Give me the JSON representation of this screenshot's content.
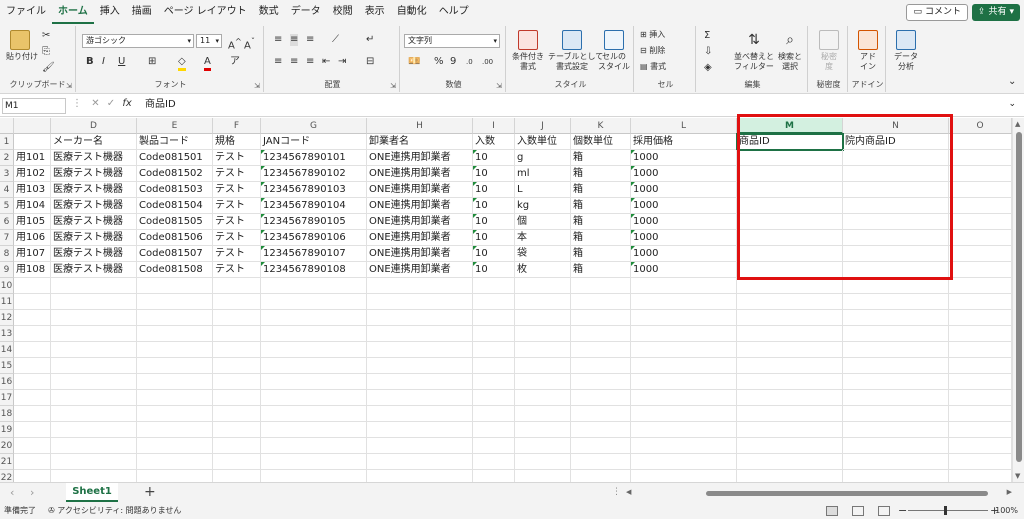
{
  "menu": [
    "ファイル",
    "ホーム",
    "挿入",
    "描画",
    "ページ レイアウト",
    "数式",
    "データ",
    "校閲",
    "表示",
    "自動化",
    "ヘルプ"
  ],
  "active_menu_index": 1,
  "top_buttons": {
    "comment": "コメント",
    "share": "共有"
  },
  "ribbon": {
    "clipboard": {
      "paste": "貼り付け",
      "label": "クリップボード"
    },
    "font": {
      "name": "游ゴシック",
      "size": "11",
      "label": "フォント"
    },
    "alignment": {
      "label": "配置"
    },
    "number": {
      "format": "文字列",
      "label": "数値"
    },
    "styles": {
      "conditional": "条件付き\n書式",
      "table": "テーブルとして\n書式設定",
      "cell_style": "セルの\nスタイル",
      "label": "スタイル"
    },
    "cells": {
      "insert": "挿入",
      "delete": "削除",
      "format": "書式",
      "label": "セル"
    },
    "editing": {
      "sort": "並べ替えと\nフィルター",
      "find": "検索と\n選択",
      "label": "編集"
    },
    "sensitivity": {
      "btn": "秘密\n度",
      "label": "秘密度"
    },
    "addins": {
      "btn": "アド\nイン",
      "label": "アドイン"
    },
    "analyze": {
      "btn": "データ\n分析"
    },
    "colors": {
      "accent": "#1e7145",
      "highlight": "#ffd700",
      "font_color": "#e00000"
    }
  },
  "formula_bar": {
    "name_box": "M1",
    "fx": "fx",
    "content": "商品ID"
  },
  "grid": {
    "columns": [
      {
        "letter": "",
        "width": 37
      },
      {
        "letter": "D",
        "width": 86
      },
      {
        "letter": "E",
        "width": 76
      },
      {
        "letter": "F",
        "width": 48
      },
      {
        "letter": "G",
        "width": 106
      },
      {
        "letter": "H",
        "width": 106
      },
      {
        "letter": "I",
        "width": 42
      },
      {
        "letter": "J",
        "width": 56
      },
      {
        "letter": "K",
        "width": 60
      },
      {
        "letter": "L",
        "width": 106
      },
      {
        "letter": "M",
        "width": 106
      },
      {
        "letter": "N",
        "width": 106
      },
      {
        "letter": "O",
        "width": 63
      }
    ],
    "selected_column": "M",
    "row_numbers": [
      "1",
      "2",
      "3",
      "4",
      "5",
      "6",
      "7",
      "8",
      "9",
      "10",
      "11",
      "12",
      "13",
      "14",
      "15",
      "16",
      "17",
      "18",
      "19",
      "20",
      "21",
      "22"
    ],
    "header_row": [
      "",
      "メーカー名",
      "製品コード",
      "規格",
      "JANコード",
      "卸業者名",
      "入数",
      "入数単位",
      "個数単位",
      "採用価格",
      "商品ID",
      "院内商品ID",
      ""
    ],
    "data_rows": [
      [
        "用101",
        "医療テスト機器",
        "Code081501",
        "テスト",
        "1234567890101",
        "ONE連携用卸業者",
        "10",
        "g",
        "箱",
        "1000",
        "",
        "",
        ""
      ],
      [
        "用102",
        "医療テスト機器",
        "Code081502",
        "テスト",
        "1234567890102",
        "ONE連携用卸業者",
        "10",
        "ml",
        "箱",
        "1000",
        "",
        "",
        ""
      ],
      [
        "用103",
        "医療テスト機器",
        "Code081503",
        "テスト",
        "1234567890103",
        "ONE連携用卸業者",
        "10",
        "L",
        "箱",
        "1000",
        "",
        "",
        ""
      ],
      [
        "用104",
        "医療テスト機器",
        "Code081504",
        "テスト",
        "1234567890104",
        "ONE連携用卸業者",
        "10",
        "kg",
        "箱",
        "1000",
        "",
        "",
        ""
      ],
      [
        "用105",
        "医療テスト機器",
        "Code081505",
        "テスト",
        "1234567890105",
        "ONE連携用卸業者",
        "10",
        "個",
        "箱",
        "1000",
        "",
        "",
        ""
      ],
      [
        "用106",
        "医療テスト機器",
        "Code081506",
        "テスト",
        "1234567890106",
        "ONE連携用卸業者",
        "10",
        "本",
        "箱",
        "1000",
        "",
        "",
        ""
      ],
      [
        "用107",
        "医療テスト機器",
        "Code081507",
        "テスト",
        "1234567890107",
        "ONE連携用卸業者",
        "10",
        "袋",
        "箱",
        "1000",
        "",
        "",
        ""
      ],
      [
        "用108",
        "医療テスト機器",
        "Code081508",
        "テスト",
        "1234567890108",
        "ONE連携用卸業者",
        "10",
        "枚",
        "箱",
        "1000",
        "",
        "",
        ""
      ]
    ],
    "text_number_columns": [
      4,
      6,
      9
    ]
  },
  "sheet_tabs": [
    "Sheet1"
  ],
  "status": {
    "ready": "準備完了",
    "accessibility": "アクセシビリティ: 問題ありません",
    "zoom": "100%"
  },
  "highlight_box_color": "#e01010"
}
